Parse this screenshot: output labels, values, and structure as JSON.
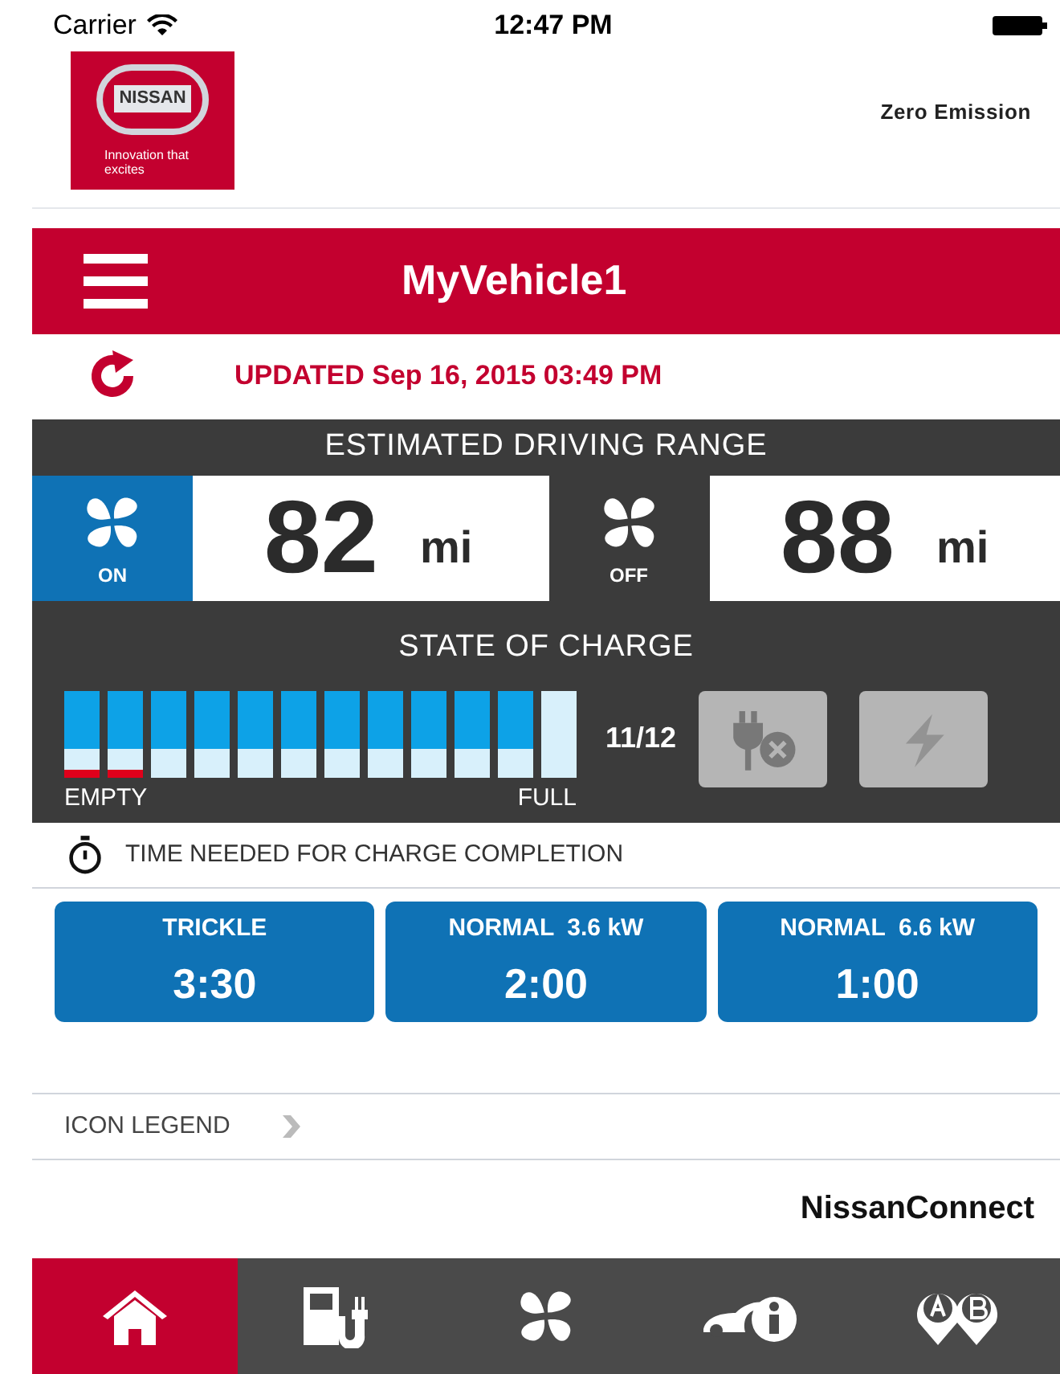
{
  "status_bar": {
    "carrier": "Carrier",
    "time": "12:47 PM"
  },
  "header": {
    "logo_text": "NISSAN",
    "logo_tagline": "Innovation that excites",
    "brand": "Zero Emission"
  },
  "title_bar": {
    "title": "MyVehicle1"
  },
  "updated": "UPDATED Sep 16, 2015 03:49 PM",
  "range": {
    "title": "ESTIMATED DRIVING RANGE",
    "items": [
      {
        "climate_on": true,
        "label": "ON",
        "value": "82",
        "unit": "mi"
      },
      {
        "climate_on": false,
        "label": "OFF",
        "value": "88",
        "unit": "mi"
      }
    ]
  },
  "charge": {
    "title": "STATE OF CHARGE",
    "reading": "11/12",
    "empty_label": "EMPTY",
    "full_label": "FULL",
    "segments": [
      {
        "filled": true,
        "warning": true
      },
      {
        "filled": true,
        "warning": true
      },
      {
        "filled": true,
        "warning": false
      },
      {
        "filled": true,
        "warning": false
      },
      {
        "filled": true,
        "warning": false
      },
      {
        "filled": true,
        "warning": false
      },
      {
        "filled": true,
        "warning": false
      },
      {
        "filled": true,
        "warning": false
      },
      {
        "filled": true,
        "warning": false
      },
      {
        "filled": true,
        "warning": false
      },
      {
        "filled": true,
        "warning": false
      },
      {
        "filled": false,
        "warning": false
      }
    ],
    "buttons": [
      {
        "kind": "plug",
        "disabled": true
      },
      {
        "kind": "bolt",
        "disabled": true
      }
    ]
  },
  "charge_time": {
    "title": "TIME NEEDED FOR CHARGE COMPLETION",
    "tiles": [
      {
        "label": "TRICKLE",
        "time": "3:30"
      },
      {
        "label": "NORMAL  3.6 kW",
        "time": "2:00"
      },
      {
        "label": "NORMAL  6.6 kW",
        "time": "1:00"
      }
    ]
  },
  "legend": "ICON LEGEND",
  "footer_brand": "NissanConnect",
  "tabs": [
    {
      "kind": "home",
      "selected": true
    },
    {
      "kind": "charging",
      "selected": false
    },
    {
      "kind": "climate",
      "selected": false
    },
    {
      "kind": "vehicle-info",
      "selected": false
    },
    {
      "kind": "route",
      "selected": false
    }
  ]
}
